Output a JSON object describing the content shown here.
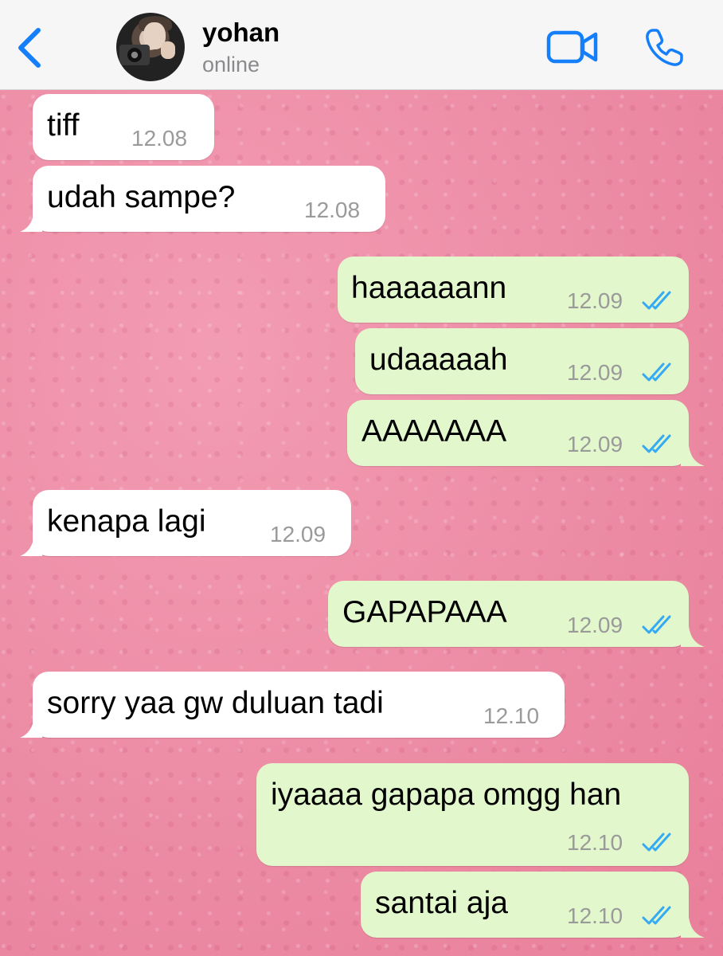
{
  "header": {
    "back_icon": "chevron-left-icon",
    "contact_name": "yohan",
    "contact_status": "online",
    "video_icon": "video-camera-icon",
    "call_icon": "phone-icon",
    "accent_color": "#147efb"
  },
  "colors": {
    "incoming_bubble": "#ffffff",
    "outgoing_bubble": "#e2f7cb",
    "read_ticks": "#34aaf5",
    "wallpaper": "#ef8fa8"
  },
  "messages": [
    {
      "direction": "in",
      "text": "tiff",
      "time": "12.08"
    },
    {
      "direction": "in",
      "text": "udah sampe?",
      "time": "12.08"
    },
    {
      "direction": "out",
      "text": "haaaaaann",
      "time": "12.09",
      "status": "read"
    },
    {
      "direction": "out",
      "text": "udaaaaah",
      "time": "12.09",
      "status": "read"
    },
    {
      "direction": "out",
      "text": "AAAAAAA",
      "time": "12.09",
      "status": "read"
    },
    {
      "direction": "in",
      "text": "kenapa lagi",
      "time": "12.09"
    },
    {
      "direction": "out",
      "text": "GAPAPAAA",
      "time": "12.09",
      "status": "read"
    },
    {
      "direction": "in",
      "text": "sorry yaa gw duluan tadi",
      "time": "12.10"
    },
    {
      "direction": "out",
      "text": "iyaaaa gapapa omgg han",
      "time": "12.10",
      "status": "read"
    },
    {
      "direction": "out",
      "text": "santai aja",
      "time": "12.10",
      "status": "read"
    }
  ]
}
